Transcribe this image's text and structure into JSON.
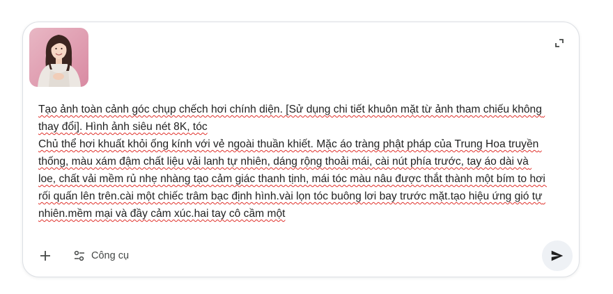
{
  "attachment": {
    "icon": "reference-photo-thumbnail",
    "description_visible": false
  },
  "prompt": {
    "text": "Tạo ảnh toàn cảnh góc chụp chếch hơi chính diện. [Sử dụng chi tiết khuôn mặt từ ảnh tham chiếu không thay đổi]. Hình ảnh siêu nét 8K, tóc\nChủ thể hơi khuất khỏi ống kính với vẻ ngoài thuần khiết. Mặc áo tràng phật pháp của Trung Hoa truyền thống, màu xám đậm chất liệu vải lanh tự nhiên, dáng rộng thoải mái, cài nút phía trước, tay áo dài và loe, chất vải mềm rủ nhẹ nhàng tạo cảm giác thanh tịnh, mái tóc màu nâu được thắt thành một bím to hơi rối quấn lên trên.cài một chiếc trâm bạc định hình.vài lọn tóc buông lơi bay trước mặt.tạo hiệu ứng gió tự nhiên.mềm mại và đầy cảm xúc.hai tay cô cầm một"
  },
  "toolbar": {
    "add_icon": "plus-icon",
    "tools_icon": "tune-icon",
    "tools_label": "Công cụ",
    "send_icon": "send-icon",
    "expand_icon": "expand-icon"
  },
  "colors": {
    "text": "#1f1f1f",
    "spellcheck_underline": "#e0302a",
    "send_button_bg": "#eef1f5",
    "border": "#dcdfe4"
  }
}
